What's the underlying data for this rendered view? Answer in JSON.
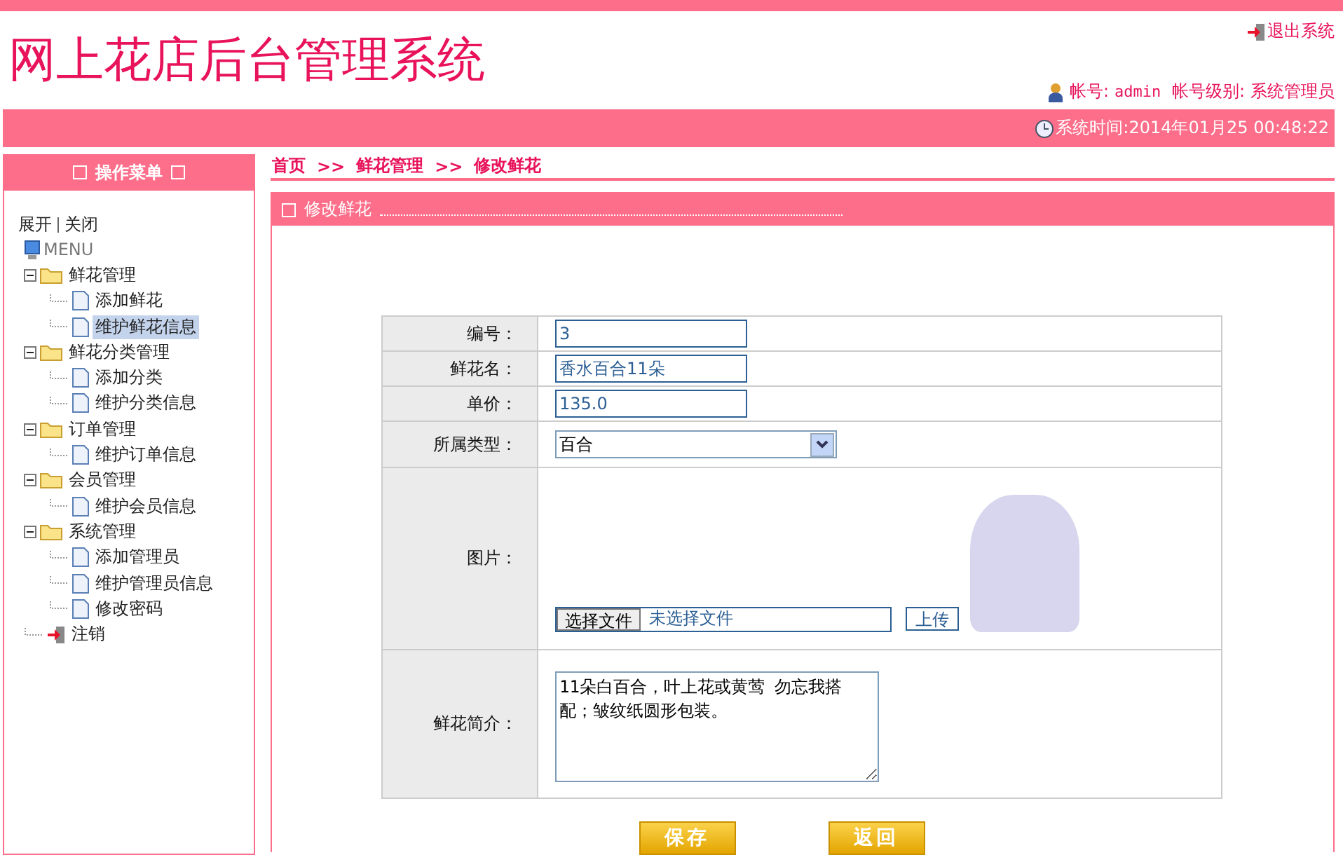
{
  "header": {
    "title": "网上花店后台管理系统",
    "logout": "退出系统",
    "account_label": "帐号:",
    "account": "admin",
    "level_label": "帐号级别:",
    "level": "系统管理员",
    "time": "系统时间:2014年01月25 00:48:22"
  },
  "sidebar": {
    "title": "操作菜单",
    "expand": "展开",
    "collapse": "关闭",
    "root": "MENU",
    "items": [
      {
        "label": "鲜花管理",
        "kind": "folder",
        "expanded": true,
        "selected": false,
        "children": [
          {
            "label": "添加鲜花",
            "kind": "page",
            "selected": false
          },
          {
            "label": "维护鲜花信息",
            "kind": "page",
            "selected": true
          }
        ]
      },
      {
        "label": "鲜花分类管理",
        "kind": "folder",
        "expanded": true,
        "selected": false,
        "children": [
          {
            "label": "添加分类",
            "kind": "page",
            "selected": false
          },
          {
            "label": "维护分类信息",
            "kind": "page",
            "selected": false
          }
        ]
      },
      {
        "label": "订单管理",
        "kind": "folder",
        "expanded": true,
        "selected": false,
        "children": [
          {
            "label": "维护订单信息",
            "kind": "page",
            "selected": false
          }
        ]
      },
      {
        "label": "会员管理",
        "kind": "folder",
        "expanded": true,
        "selected": false,
        "children": [
          {
            "label": "维护会员信息",
            "kind": "page",
            "selected": false
          }
        ]
      },
      {
        "label": "系统管理",
        "kind": "folder",
        "expanded": true,
        "selected": false,
        "children": [
          {
            "label": "添加管理员",
            "kind": "page",
            "selected": false
          },
          {
            "label": "维护管理员信息",
            "kind": "page",
            "selected": false
          },
          {
            "label": "修改密码",
            "kind": "page",
            "selected": false
          }
        ]
      },
      {
        "label": "注销",
        "kind": "exit",
        "selected": false
      }
    ]
  },
  "breadcrumb": [
    "首页",
    "鲜花管理",
    "修改鲜花"
  ],
  "breadcrumb_separator": ">>",
  "panel": {
    "title": "修改鲜花",
    "rows": [
      {
        "kind": "text",
        "label": "编号：",
        "value": "3"
      },
      {
        "kind": "text",
        "label": "鲜花名：",
        "value": "香水百合11朵"
      },
      {
        "kind": "text",
        "label": "单价：",
        "value": "135.0"
      },
      {
        "kind": "select",
        "label": "所属类型：",
        "value": "百合"
      },
      {
        "kind": "image",
        "label": "图片：",
        "file_button": "选择文件",
        "file_status": "未选择文件",
        "upload": "上传"
      },
      {
        "kind": "textarea",
        "label": "鲜花简介：",
        "value": "11朵白百合，叶上花或黄莺 勿忘我搭配；皱纹纸圆形包装。"
      }
    ]
  },
  "buttons": [
    "保存",
    "返回"
  ]
}
